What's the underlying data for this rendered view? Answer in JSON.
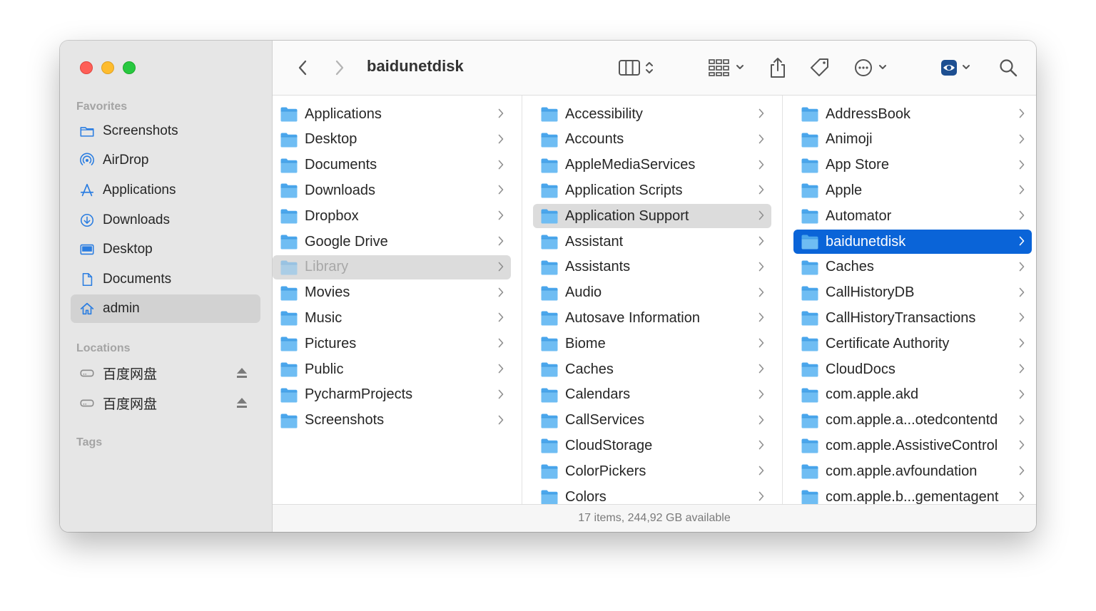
{
  "window": {
    "title": "baidunetdisk"
  },
  "sidebar": {
    "favorites_header": "Favorites",
    "favorites": [
      {
        "label": "Screenshots",
        "icon": "folder-icon"
      },
      {
        "label": "AirDrop",
        "icon": "airdrop-icon"
      },
      {
        "label": "Applications",
        "icon": "applications-icon"
      },
      {
        "label": "Downloads",
        "icon": "download-circle-icon"
      },
      {
        "label": "Desktop",
        "icon": "desktop-icon"
      },
      {
        "label": "Documents",
        "icon": "document-icon"
      },
      {
        "label": "admin",
        "icon": "home-icon",
        "selected": true
      }
    ],
    "locations_header": "Locations",
    "locations": [
      {
        "label": "百度网盘",
        "icon": "drive-icon",
        "eject_icon": "eject-icon"
      },
      {
        "label": "百度网盘",
        "icon": "drive-icon",
        "eject_icon": "eject-icon"
      }
    ],
    "tags_header": "Tags"
  },
  "toolbar": {
    "back_icon": "chevron-left-icon",
    "forward_icon": "chevron-right-icon",
    "view_icon": "column-view-icon",
    "group_icon": "grid-group-icon",
    "share_icon": "share-icon",
    "tag_icon": "tag-icon",
    "more_icon": "ellipsis-circle-icon",
    "preview_icon": "eye-icon",
    "search_icon": "search-icon"
  },
  "columns": [
    {
      "items": [
        {
          "label": "Applications",
          "icon": "applications-folder-icon"
        },
        {
          "label": "Desktop",
          "icon": "desktop-folder-icon"
        },
        {
          "label": "Documents",
          "icon": "documents-folder-icon"
        },
        {
          "label": "Downloads",
          "icon": "downloads-folder-icon"
        },
        {
          "label": "Dropbox",
          "icon": "folder-icon"
        },
        {
          "label": "Google Drive",
          "icon": "folder-icon"
        },
        {
          "label": "Library",
          "icon": "folder-icon",
          "state": "path-dim"
        },
        {
          "label": "Movies",
          "icon": "movies-folder-icon"
        },
        {
          "label": "Music",
          "icon": "music-folder-icon"
        },
        {
          "label": "Pictures",
          "icon": "pictures-folder-icon"
        },
        {
          "label": "Public",
          "icon": "public-folder-icon"
        },
        {
          "label": "PycharmProjects",
          "icon": "folder-icon"
        },
        {
          "label": "Screenshots",
          "icon": "folder-icon"
        }
      ]
    },
    {
      "items": [
        {
          "label": "Accessibility"
        },
        {
          "label": "Accounts"
        },
        {
          "label": "AppleMediaServices"
        },
        {
          "label": "Application Scripts"
        },
        {
          "label": "Application Support",
          "state": "path"
        },
        {
          "label": "Assistant"
        },
        {
          "label": "Assistants"
        },
        {
          "label": "Audio"
        },
        {
          "label": "Autosave Information"
        },
        {
          "label": "Biome"
        },
        {
          "label": "Caches"
        },
        {
          "label": "Calendars"
        },
        {
          "label": "CallServices"
        },
        {
          "label": "CloudStorage"
        },
        {
          "label": "ColorPickers"
        },
        {
          "label": "Colors"
        }
      ]
    },
    {
      "items": [
        {
          "label": "AddressBook"
        },
        {
          "label": "Animoji"
        },
        {
          "label": "App Store"
        },
        {
          "label": "Apple"
        },
        {
          "label": "Automator"
        },
        {
          "label": "baidunetdisk",
          "state": "selected"
        },
        {
          "label": "Caches"
        },
        {
          "label": "CallHistoryDB"
        },
        {
          "label": "CallHistoryTransactions"
        },
        {
          "label": "Certificate Authority"
        },
        {
          "label": "CloudDocs"
        },
        {
          "label": "com.apple.akd"
        },
        {
          "label": "com.apple.a...otedcontentd"
        },
        {
          "label": "com.apple.AssistiveControl"
        },
        {
          "label": "com.apple.avfoundation"
        },
        {
          "label": "com.apple.b...gementagent"
        }
      ]
    }
  ],
  "status": {
    "text": "17 items, 244,92 GB available"
  },
  "colors": {
    "accent": "#0a64d8",
    "folder": "#5fb3f0",
    "sidebar_icon": "#2a7de1"
  }
}
